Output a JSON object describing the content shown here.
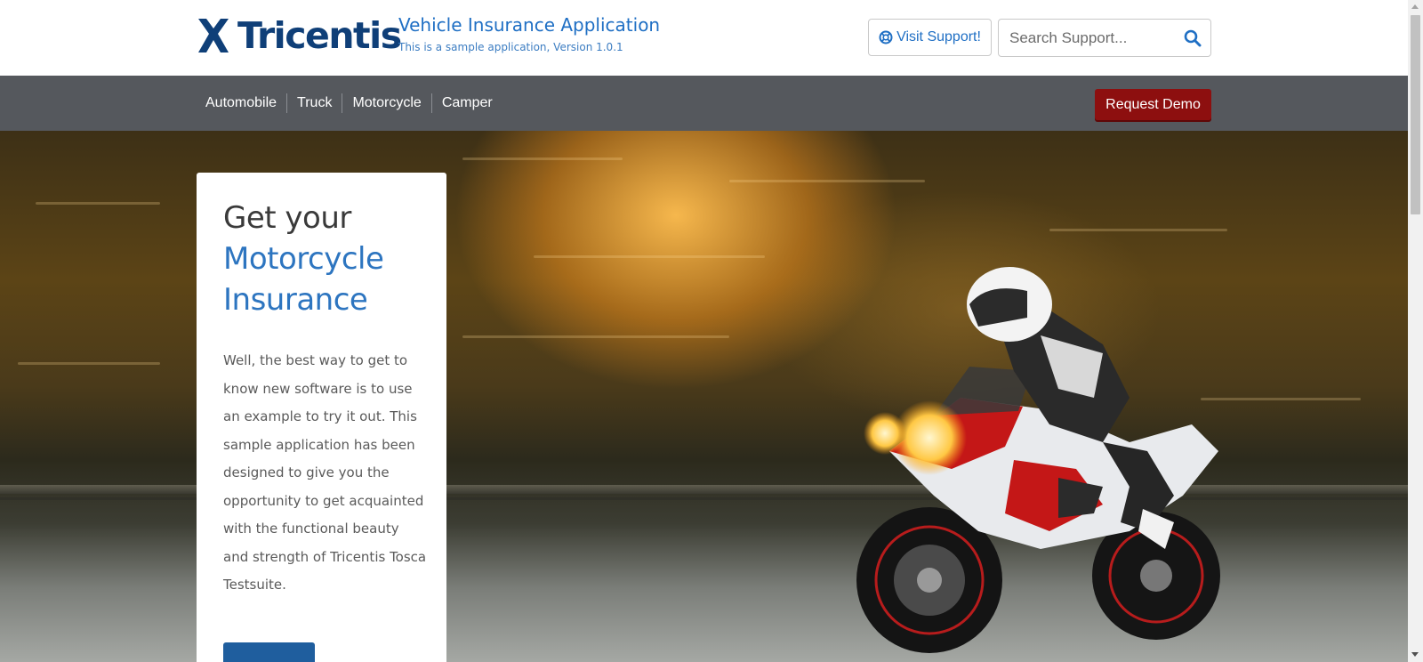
{
  "header": {
    "logo_text": "Tricentis",
    "app_title": "Vehicle Insurance Application",
    "app_subtitle": "This is a sample application, Version 1.0.1",
    "support_button": "Visit Support!",
    "search_placeholder": "Search Support..."
  },
  "nav": {
    "items": [
      "Automobile",
      "Truck",
      "Motorcycle",
      "Camper"
    ],
    "request_demo": "Request Demo"
  },
  "hero": {
    "title_line1": "Get your",
    "title_highlight_1": "Motorcycle",
    "title_highlight_2": "Insurance",
    "body": "Well, the best way to get to know new software is to use an example to try it out. This sample application has been designed to give you the opportunity to get acquainted with the functional beauty and strength of Tricentis Tosca Testsuite."
  },
  "colors": {
    "brand_dark": "#0f3f78",
    "link_blue": "#1f6fc4",
    "nav_bg": "#55585d",
    "demo_red": "#8d0f0f"
  },
  "icons": {
    "logo": "tricentis-x-logo",
    "support": "lifebuoy-icon",
    "search": "search-icon",
    "hero_image": "motorcycle-rider-photo"
  }
}
